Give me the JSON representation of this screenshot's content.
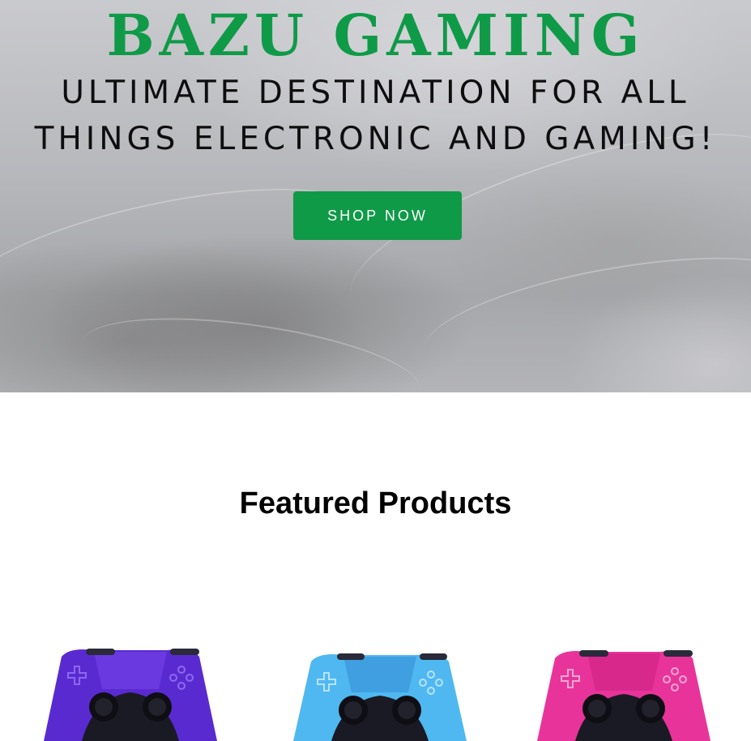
{
  "hero": {
    "title": "BAZU GAMING",
    "subtitle_line1": "ULTIMATE DESTINATION FOR ALL",
    "subtitle_line2": "THINGS ELECTRONIC AND GAMING!",
    "cta_label": "SHOP NOW",
    "brand_color": "#0f9a48"
  },
  "featured": {
    "title": "Featured Products",
    "products": [
      {
        "name": "purple-controller",
        "color": "#5a2ad1",
        "dark": "#3a17a0"
      },
      {
        "name": "blue-controller",
        "color": "#4fb8f0",
        "dark": "#2d86d8"
      },
      {
        "name": "pink-controller",
        "color": "#e8349a",
        "dark": "#b81d7a"
      }
    ]
  }
}
